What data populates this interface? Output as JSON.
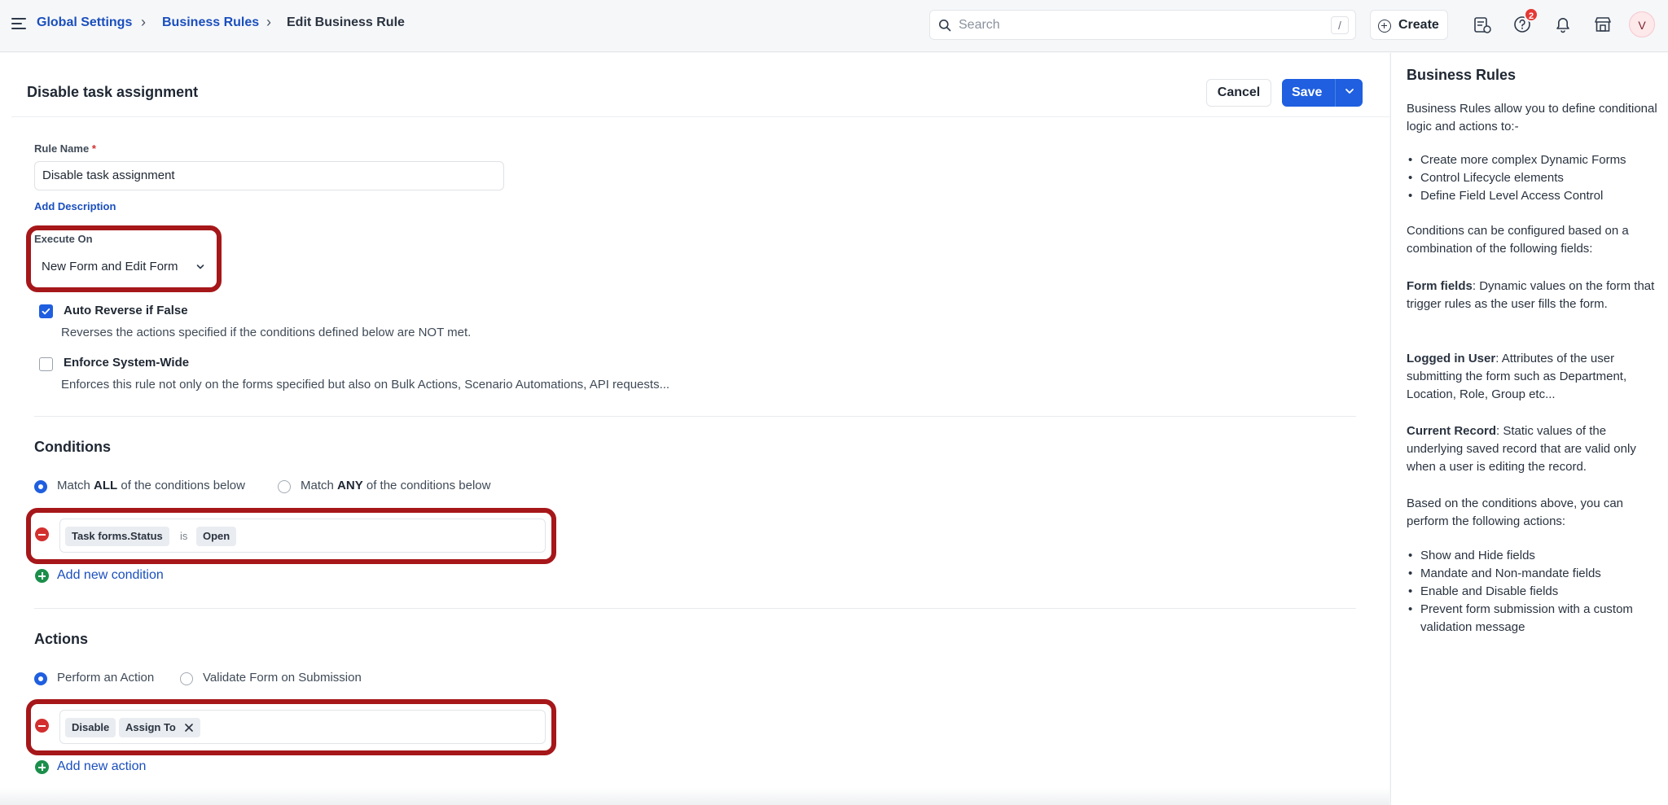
{
  "breadcrumb": {
    "items": [
      "Global Settings",
      "Business Rules"
    ],
    "current": "Edit Business Rule"
  },
  "search": {
    "placeholder": "Search",
    "shortcut": "/"
  },
  "topbar": {
    "create_label": "Create",
    "help_badge_count": "2",
    "avatar_initial": "V"
  },
  "form": {
    "title": "Disable task assignment",
    "cancel_label": "Cancel",
    "save_label": "Save",
    "rule_name_label": "Rule Name",
    "required_mark": "*",
    "rule_name_value": "Disable task assignment",
    "add_description_label": "Add Description",
    "execute_on_label": "Execute On",
    "execute_on_value": "New Form and Edit Form",
    "auto_reverse": {
      "checked": true,
      "title": "Auto Reverse if False",
      "description": "Reverses the actions specified if the conditions defined below are NOT met."
    },
    "enforce_system_wide": {
      "checked": false,
      "title": "Enforce System-Wide",
      "description": "Enforces this rule not only on the forms specified but also on Bulk Actions, Scenario Automations, API requests..."
    }
  },
  "conditions": {
    "title": "Conditions",
    "match_all_pre": "Match",
    "match_all_bold": "ALL",
    "match_all_post": "of the conditions below",
    "match_any_pre": "Match",
    "match_any_bold": "ANY",
    "match_any_post": "of the conditions below",
    "selected": "all",
    "rule": {
      "field": "Task forms.Status",
      "operator": "is",
      "value": "Open"
    },
    "add_label": "Add new condition"
  },
  "actions": {
    "title": "Actions",
    "perform_label": "Perform an Action",
    "validate_label": "Validate Form on Submission",
    "selected": "perform",
    "rule": {
      "action": "Disable",
      "target": "Assign To"
    },
    "add_label": "Add new action"
  },
  "help_panel": {
    "title": "Business Rules",
    "intro": "Business Rules allow you to define conditional logic and actions to:-",
    "uses": [
      "Create more complex Dynamic Forms",
      "Control Lifecycle elements",
      "Define Field Level Access Control"
    ],
    "conditions_intro": "Conditions can be configured based on a combination of the following fields:",
    "form_fields_term": "Form fields",
    "form_fields_desc": ": Dynamic values on the form that trigger rules as the user fills the form.",
    "logged_in_term": "Logged in User",
    "logged_in_desc": ": Attributes of the user submitting the form such as Department, Location, Role, Group etc...",
    "current_record_term": "Current Record",
    "current_record_desc": ": Static values of the underlying saved record that are valid only when a user is editing the record.",
    "actions_intro": "Based on the conditions above, you can perform the following actions:",
    "actions_list": [
      "Show and Hide fields",
      "Mandate and Non-mandate fields",
      "Enable and Disable fields",
      "Prevent form submission with a custom validation message"
    ]
  },
  "colors": {
    "primary": "#1f5fe0",
    "link": "#1a4fbd",
    "highlight": "#a6171a",
    "remove": "#d32f2f",
    "add": "#1b8f4b"
  }
}
